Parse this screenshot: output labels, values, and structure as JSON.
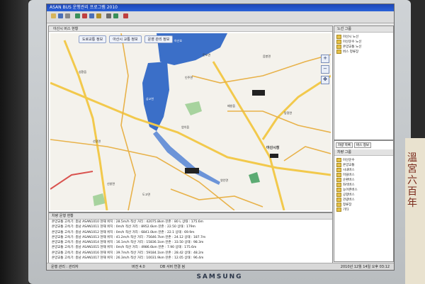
{
  "window": {
    "title": "ASAN BUS 운행관리 프로그램 2010"
  },
  "map": {
    "panel_title": "아산시 버스 현황",
    "tabs": [
      "도로교통 정보",
      "아산시 교통 정보",
      "운영 관리 정보"
    ],
    "places": [
      "성환읍",
      "둔포면",
      "음봉면",
      "배방읍",
      "아산시청",
      "탕정면",
      "신창면",
      "도고면",
      "염치읍",
      "영인면",
      "인주면",
      "선장면",
      "삽교천",
      "아산호"
    ]
  },
  "right_panel": {
    "title": "노선 그룹",
    "tree": [
      "아산시 노선",
      "아산운수 노선",
      "온양교통 노선",
      "버스 정류장"
    ]
  },
  "right_panel2": {
    "tabs": [
      "차량 목록",
      "버스 정보"
    ],
    "title": "차량 그룹",
    "tree": [
      "아산운수",
      "온양교통",
      "시내버스",
      "마을버스",
      "순환버스",
      "좌석버스",
      "농어촌버스",
      "공항버스",
      "관광버스",
      "정류장",
      "기타"
    ]
  },
  "log": {
    "title": "차량 운행 현황",
    "rows": [
      "온양교통 고속기: 충남 ASAN1010 현재 위치 : 28.5m/h 적산 거리 : 42075.8km 잔존 : 80 L 상태 : 175.6m",
      "온양교통 고속기: 충남 ASAN1011 현재 위치 : 0m/h 적산 거리 : 8952.6km 잔존 : 22.50 상태 : 179m",
      "온양교통 고속기: 충남 ASAN1012 현재 위치 : 0m/h 적산 거리 : 6841.0km 잔존 : 22.1 상태 : 69.9m",
      "온양교통 고속기: 충남 ASAN1013 현재 위치 : 41.2m/h 적산 거리 : 75646.7km 잔존 : 24.12 상태 : 187.7m",
      "온양교통 고속기: 충남 ASAN1014 현재 위치 : 16.1m/h 적산 거리 : 15836.1km 잔존 : 33.50 상태 : 98.3m",
      "온양교통 고속기: 충남 ASAN1015 현재 위치 : 0m/h 적산 거리 : 4986.6km 잔존 : 7.90 상태 : 175.6m",
      "온양교통 고속기: 충남 ASAN1016 현재 위치 : 39.7m/h 적산 거리 : 59184.1km 잔존 : 28.42 상태 : 48.2m",
      "온양교통 고속기: 충남 ASAN1017 현재 위치 : 26.3m/h 적산 거리 : 10031.9km 잔존 : 12.05 상태 : 96.4m"
    ]
  },
  "status": {
    "left": "운행 관리 : 관리자",
    "mid": "버전 4.0",
    "mid2": "DB 서버 연결 됨",
    "right": "2010년 12월 14일 오후 03:12"
  },
  "monitor_brand": "SAMSUNG",
  "book": {
    "spine": "溫宮六百年"
  },
  "colors": {
    "water": "#3b6fc8",
    "road_major": "#f2c94c",
    "road_minor": "#e8b24a",
    "green": "#5cab73",
    "title_blue": "#2a62d8"
  }
}
